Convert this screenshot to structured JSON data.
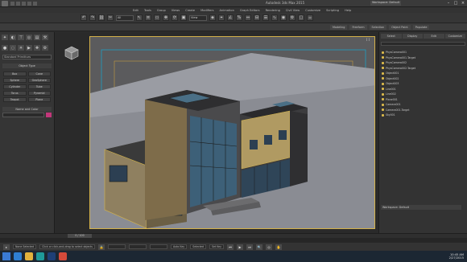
{
  "app": {
    "title": "Autodesk 3ds Max 2015",
    "workspace": "Workspace: Default"
  },
  "menubar": {
    "items": [
      "Edit",
      "Tools",
      "Group",
      "Views",
      "Create",
      "Modifiers",
      "Animation",
      "Graph Editors",
      "Rendering",
      "Civil View",
      "Customize",
      "Scripting",
      "Help"
    ]
  },
  "toolbar": {
    "selection_filter": "All",
    "view_dropdown": "View"
  },
  "ribbon": {
    "tabs": [
      "Modeling",
      "Freeform",
      "Selection",
      "Object Paint",
      "Populate"
    ]
  },
  "left_panel": {
    "dropdown": "Standard Primitives",
    "rollout_title": "Object Type",
    "object_buttons": [
      "Box",
      "Cone",
      "Sphere",
      "GeoSphere",
      "Cylinder",
      "Tube",
      "Torus",
      "Pyramid",
      "Teapot",
      "Plane"
    ],
    "name_color_title": "Name and Color"
  },
  "viewport": {
    "label": "[+] [Perspective] [Realistic]",
    "label_right": "[ ]"
  },
  "right_panel": {
    "tabs": [
      "Select",
      "Display",
      "Edit",
      "Customize"
    ],
    "scene_items": [
      "PhysCamera001",
      "PhysCamera001.Target",
      "PhysCamera002",
      "PhysCamera002.Target",
      "Object001",
      "Object002",
      "Object003",
      "Line001",
      "Line002",
      "Plane001",
      "Camera001",
      "Camera001.Target",
      "Sky001"
    ],
    "bottom_label": "Workspace: Default"
  },
  "timeline": {
    "frame": "0 / 100"
  },
  "status": {
    "selected": "None Selected",
    "prompt": "Click or click-and-drag to select objects",
    "auto_key": "Auto Key",
    "set_key": "Set Key",
    "selected_dd": "Selected"
  },
  "taskbar": {
    "time": "10:45 AM",
    "date": "2/27/2015"
  }
}
